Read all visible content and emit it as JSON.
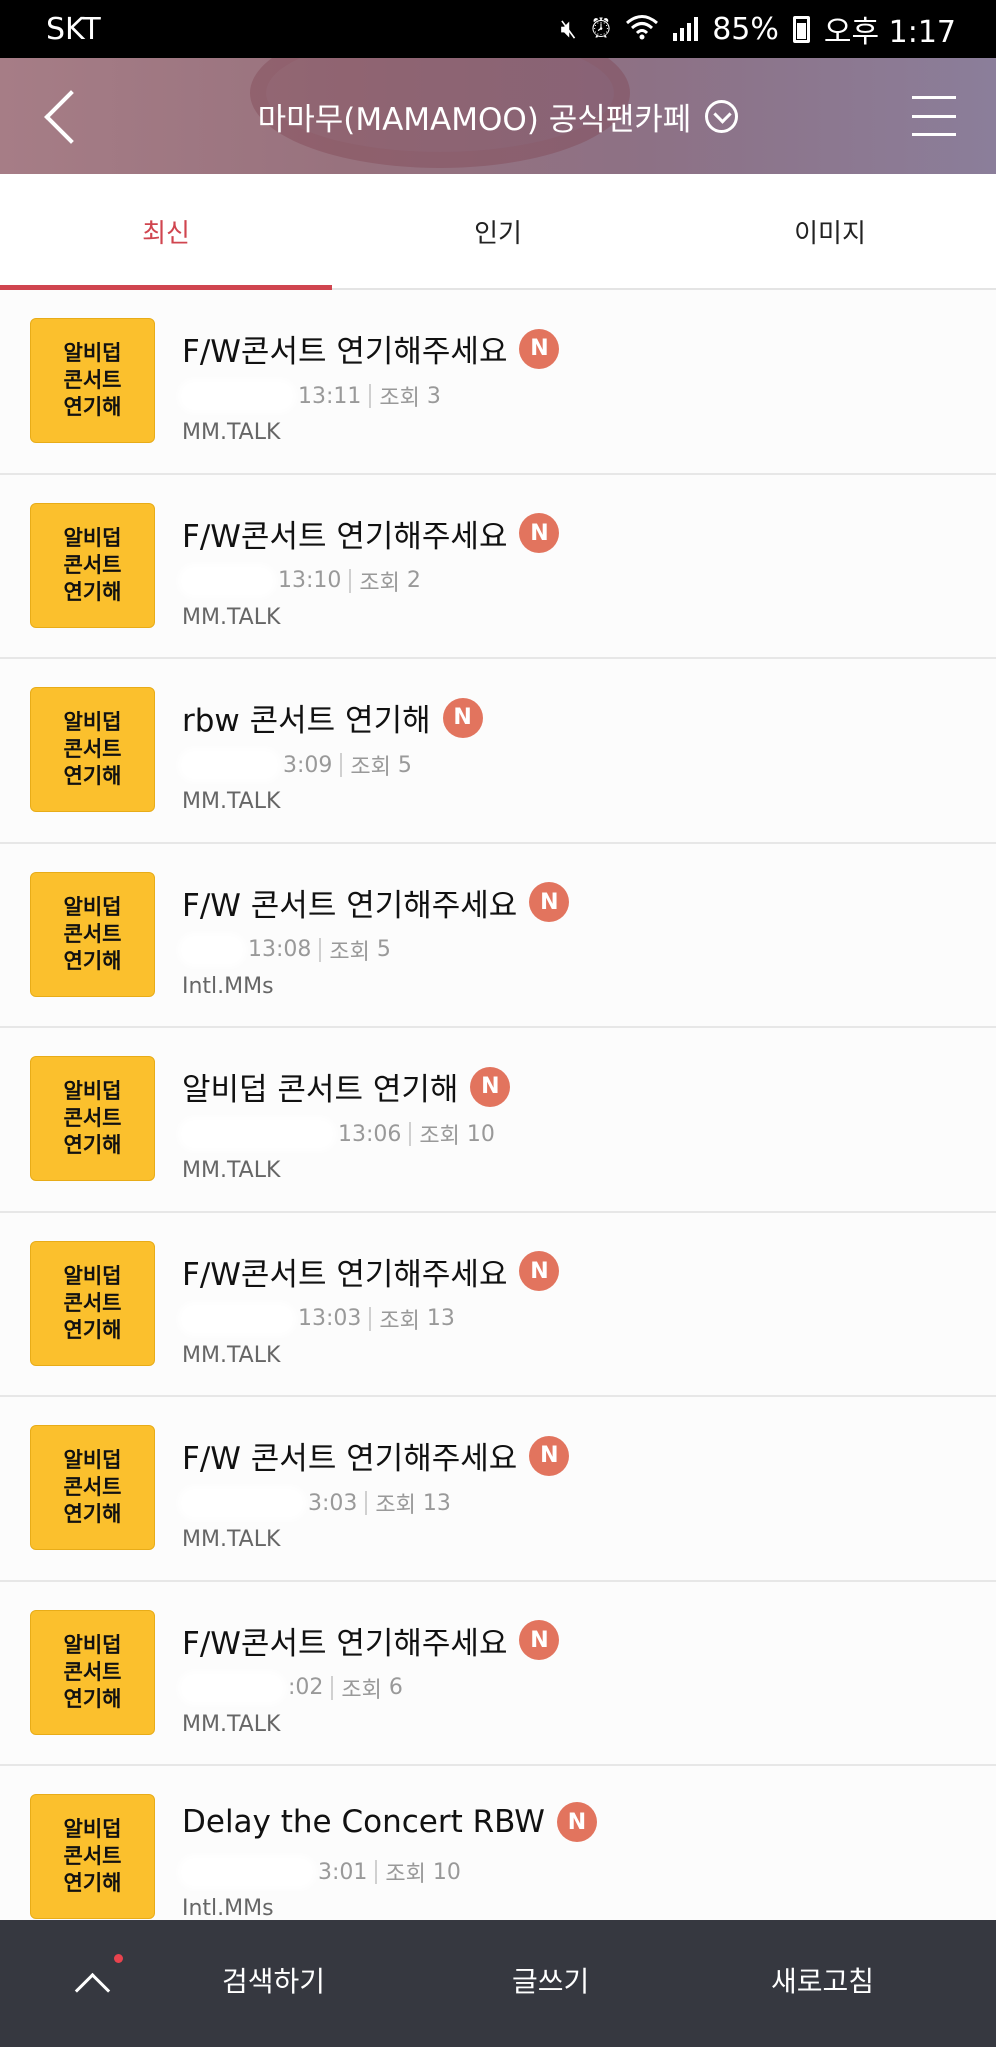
{
  "status_bar": {
    "carrier": "SKT",
    "icons": [
      "mute-icon",
      "alarm-icon",
      "wifi-icon",
      "signal-icon",
      "battery-icon"
    ],
    "battery": "85%",
    "time": "오후 1:17"
  },
  "header": {
    "title": "마마무(MAMAMOO) 공식팬카페",
    "colors": {
      "background": "#98727e",
      "text": "#ffffff"
    }
  },
  "tabs": [
    {
      "label": "최신",
      "active": true
    },
    {
      "label": "인기",
      "active": false
    },
    {
      "label": "이미지",
      "active": false
    }
  ],
  "accent_color": "#d0454f",
  "thumbnail": {
    "lines": [
      "알비덥",
      "콘서트",
      "연기해"
    ],
    "color": "#fbc02d"
  },
  "new_badge": "N",
  "views_label": "조회",
  "posts": [
    {
      "title": "F/W콘서트 연기해주세요",
      "time": "13:11",
      "views": "3",
      "board": "MM.TALK"
    },
    {
      "title": "F/W콘서트 연기해주세요",
      "time": "13:10",
      "views": "2",
      "board": "MM.TALK"
    },
    {
      "title": "rbw 콘서트 연기해",
      "time": "3:09",
      "views": "5",
      "board": "MM.TALK"
    },
    {
      "title": "F/W 콘서트 연기해주세요",
      "time": "13:08",
      "views": "5",
      "board": "Intl.MMs"
    },
    {
      "title": "알비덥 콘서트 연기해",
      "time": "13:06",
      "views": "10",
      "board": "MM.TALK"
    },
    {
      "title": "F/W콘서트 연기해주세요",
      "time": "13:03",
      "views": "13",
      "board": "MM.TALK"
    },
    {
      "title": "F/W 콘서트 연기해주세요",
      "time": "3:03",
      "views": "13",
      "board": "MM.TALK"
    },
    {
      "title": "F/W콘서트 연기해주세요",
      "time": ":02",
      "views": "6",
      "board": "MM.TALK"
    },
    {
      "title": "Delay the Concert RBW",
      "time": "3:01",
      "views": "10",
      "board": "Intl.MMs"
    }
  ],
  "bottom_bar": {
    "search": "검색하기",
    "write": "글쓰기",
    "refresh": "새로고침"
  }
}
